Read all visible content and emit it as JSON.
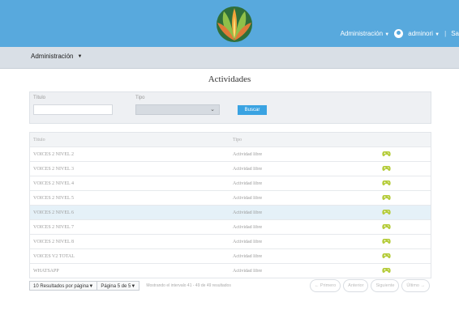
{
  "header": {
    "admin_menu": "Administración",
    "user_menu": "adminori",
    "cutoff_text": "Sa"
  },
  "subnav": {
    "admin": "Administración"
  },
  "page": {
    "title": "Actividades"
  },
  "filters": {
    "title_label": "Título",
    "title_value": "",
    "type_label": "Tipo",
    "type_value": "",
    "search_button": "Buscar"
  },
  "table": {
    "headers": [
      "Título",
      "Tipo",
      ""
    ],
    "rows": [
      {
        "title": "VOICES 2 NIVEL 2",
        "type": "Actividad libre"
      },
      {
        "title": "VOICES 2 NIVEL 3",
        "type": "Actividad libre"
      },
      {
        "title": "VOICES 2 NIVEL 4",
        "type": "Actividad libre"
      },
      {
        "title": "VOICES 2 NIVEL 5",
        "type": "Actividad libre"
      },
      {
        "title": "VOICES 2 NIVEL 6",
        "type": "Actividad libre"
      },
      {
        "title": "VOICES 2 NIVEL 7",
        "type": "Actividad libre"
      },
      {
        "title": "VOICES 2 NIVEL 8",
        "type": "Actividad libre"
      },
      {
        "title": "VOICES V2 TOTAL",
        "type": "Actividad libre"
      },
      {
        "title": "WHATSAPP",
        "type": "Actividad libre"
      }
    ],
    "highlighted_row_index": 4,
    "action_icon": "gamepad-icon",
    "icon_color": "#b5cc3a"
  },
  "footer": {
    "per_page": "10 Resultados por página",
    "page_of": "Página 5 de 5",
    "showing": "Mostrando el intervalo 41 - 49 de 49 resultados",
    "first": "← Primero",
    "prev": "Anterior",
    "next": "Siguiente",
    "last": "Último →"
  },
  "colors": {
    "topbar": "#58a9dd",
    "search_button": "#3aa3e2",
    "highlight_row": "#e5f1f8"
  }
}
